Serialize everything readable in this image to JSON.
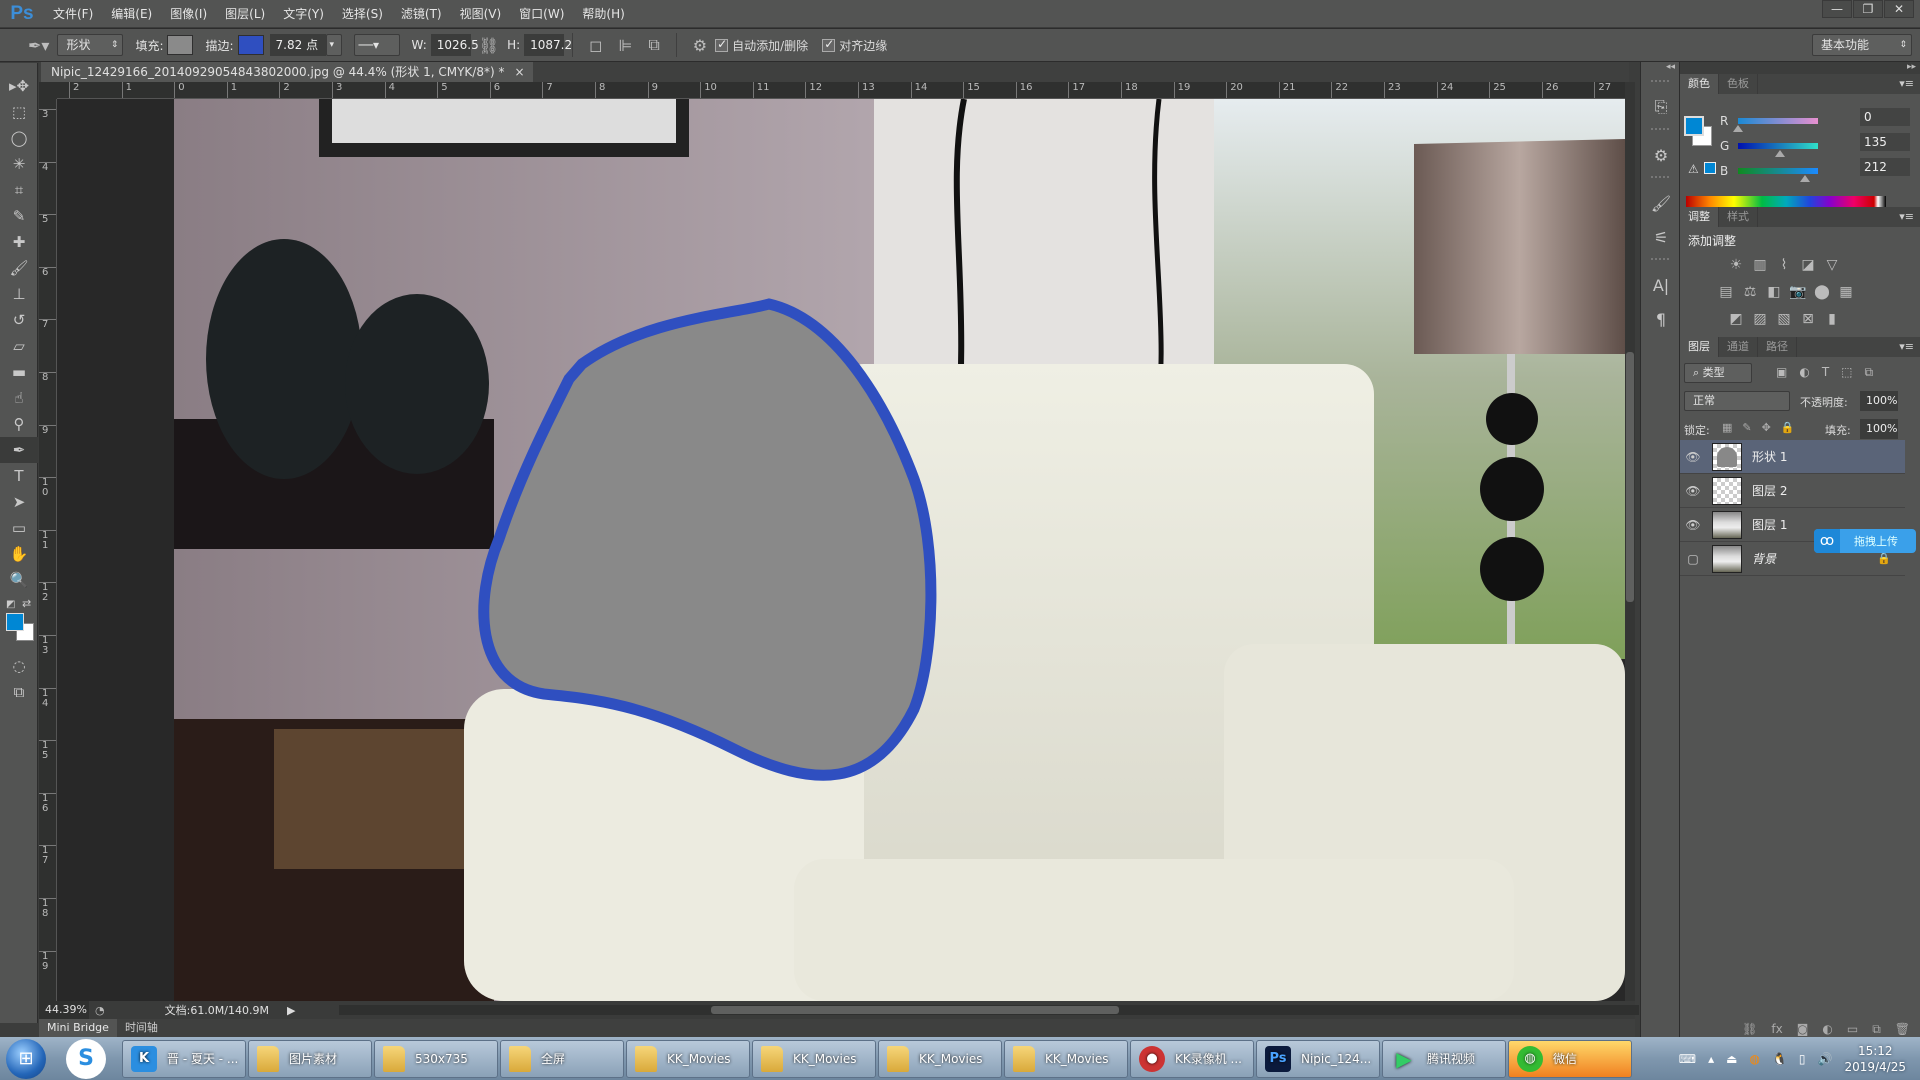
{
  "app": {
    "logo": "Ps",
    "menu": [
      "文件(F)",
      "编辑(E)",
      "图像(I)",
      "图层(L)",
      "文字(Y)",
      "选择(S)",
      "滤镜(T)",
      "视图(V)",
      "窗口(W)",
      "帮助(H)"
    ],
    "window_controls": {
      "minimize": "—",
      "restore": "❐",
      "close": "✕"
    }
  },
  "options_bar": {
    "tool_icon": "pen-tool-icon",
    "mode": "形状",
    "fill_label": "填充:",
    "fill_color": "#8a8a8a",
    "stroke_label": "描边:",
    "stroke_color": "#2f4fc0",
    "stroke_width": "7.82 点",
    "w_label": "W:",
    "w_value": "1026.5",
    "h_label": "H:",
    "h_value": "1087.2",
    "auto_add_delete": "自动添加/删除",
    "auto_add_delete_checked": true,
    "align_edges": "对齐边缘",
    "align_edges_checked": true,
    "workspace": "基本功能"
  },
  "document": {
    "tab_title": "Nipic_12429166_20140929054843802000.jpg @ 44.4% (形状 1, CMYK/8*) *",
    "close": "×",
    "zoom": "44.39%",
    "doc_info": "文档:61.0M/140.9M",
    "ruler_top": [
      "2",
      "1",
      "0",
      "1",
      "2",
      "3",
      "4",
      "5",
      "6",
      "7",
      "8",
      "9",
      "10",
      "11",
      "12",
      "13",
      "14",
      "15",
      "16",
      "17",
      "18",
      "19",
      "20",
      "21",
      "22",
      "23",
      "24",
      "25",
      "26",
      "27"
    ],
    "ruler_left": [
      "3",
      "4",
      "5",
      "6",
      "7",
      "8",
      "9",
      "10",
      "11",
      "12",
      "13",
      "14",
      "15",
      "16",
      "17",
      "18",
      "19"
    ],
    "shape_fill": "#898989",
    "shape_stroke": "#2f4fc0"
  },
  "bottom_tabs": [
    "Mini Bridge",
    "时间轴"
  ],
  "tools": [
    "move-tool",
    "marquee-tool",
    "lasso-tool",
    "magic-wand-tool",
    "crop-tool",
    "eyedropper-tool",
    "healing-brush-tool",
    "brush-tool",
    "clone-stamp-tool",
    "history-brush-tool",
    "eraser-tool",
    "gradient-tool",
    "smudge-tool",
    "dodge-tool",
    "pen-tool",
    "type-tool",
    "path-selection-tool",
    "rectangle-tool",
    "hand-tool",
    "zoom-tool"
  ],
  "tool_glyphs": [
    "▸✥",
    "⬚",
    "◯",
    "✳",
    "⌗",
    "✎",
    "✚",
    "🖌",
    "⊥",
    "↺",
    "▱",
    "▬",
    "☝",
    "⚲",
    "✒",
    "T",
    "➤",
    "▭",
    "✋",
    "🔍"
  ],
  "colors": {
    "foreground": "#0087d4",
    "background": "#ffffff"
  },
  "color_panel": {
    "tabs": [
      "颜色",
      "色板"
    ],
    "r_label": "R",
    "r": "0",
    "g_label": "G",
    "g": "135",
    "b_label": "B",
    "b": "212"
  },
  "adjustments_panel": {
    "tabs": [
      "调整",
      "样式"
    ],
    "title": "添加调整",
    "row1": [
      "☀",
      "▥",
      "⌇",
      "◪",
      "▽"
    ],
    "row2": [
      "▤",
      "⚖",
      "◧",
      "📷",
      "⬤",
      "▦"
    ],
    "row3": [
      "◩",
      "▨",
      "▧",
      "⊠",
      "▮"
    ]
  },
  "layers_panel": {
    "tabs": [
      "图层",
      "通道",
      "路径"
    ],
    "filter": "类型",
    "blend_mode": "正常",
    "opacity_label": "不透明度:",
    "opacity": "100%",
    "lock_label": "锁定:",
    "fill_label": "填充:",
    "fill": "100%",
    "layers": [
      {
        "name": "形状 1",
        "visible": true,
        "selected": true
      },
      {
        "name": "图层 2",
        "visible": true,
        "selected": false
      },
      {
        "name": "图层 1",
        "visible": true,
        "selected": false
      },
      {
        "name": "背景",
        "visible": false,
        "selected": false,
        "locked": true
      }
    ],
    "upload_label": "拖拽上传"
  },
  "taskbar": {
    "items": [
      {
        "label": "晋 - 夏天 - ...",
        "icon": "K"
      },
      {
        "label": "图片素材",
        "icon": "folder"
      },
      {
        "label": "530x735",
        "icon": "folder"
      },
      {
        "label": "全屏",
        "icon": "folder"
      },
      {
        "label": "KK_Movies",
        "icon": "folder"
      },
      {
        "label": "KK_Movies",
        "icon": "folder"
      },
      {
        "label": "KK_Movies",
        "icon": "folder"
      },
      {
        "label": "KK_Movies",
        "icon": "folder"
      },
      {
        "label": "KK录像机 ...",
        "icon": "kk"
      },
      {
        "label": "Nipic_124...",
        "icon": "Ps"
      },
      {
        "label": "腾讯视频",
        "icon": "▶"
      },
      {
        "label": "微信",
        "icon": "wechat"
      }
    ],
    "time": "15:12",
    "date": "2019/4/25"
  }
}
